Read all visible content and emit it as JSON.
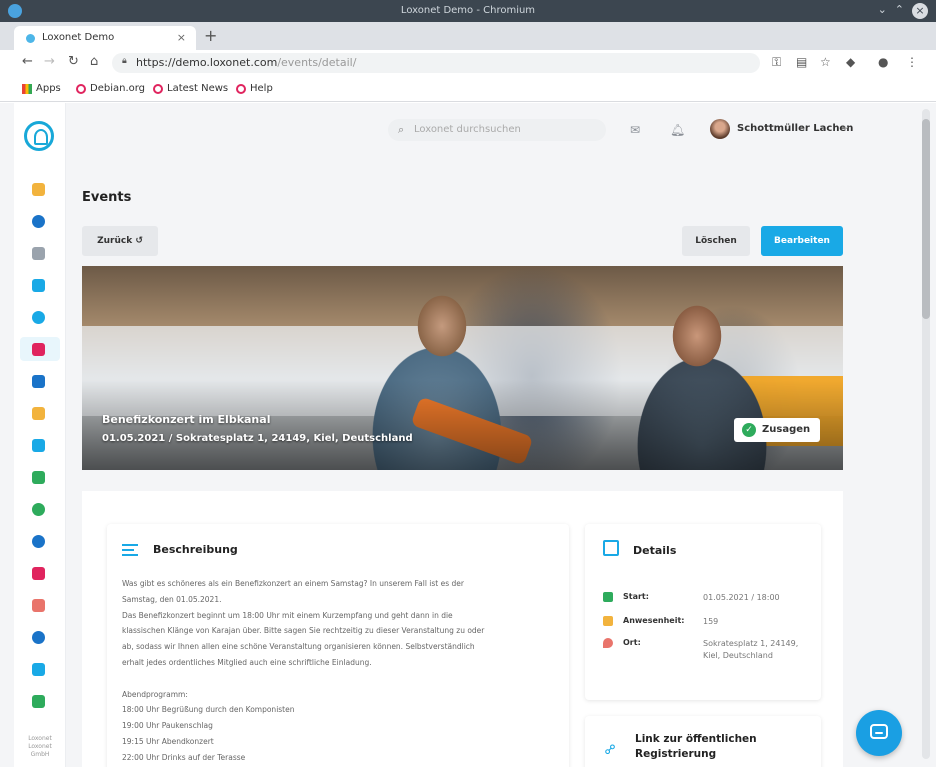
{
  "os": {
    "title": "Loxonet Demo - Chromium"
  },
  "browser": {
    "tab_label": "Loxonet Demo",
    "url_host": "https://demo.loxonet.com",
    "url_path": "/events/detail/",
    "bookmarks": [
      "Apps",
      "Debian.org",
      "Latest News",
      "Help"
    ]
  },
  "sidebar": {
    "footer": "Loxonet\nLoxonet\nGmbH"
  },
  "header": {
    "search_placeholder": "Loxonet durchsuchen",
    "username": "Schottmüller Lachen"
  },
  "page": {
    "title": "Events",
    "back_label": "Zurück",
    "delete_label": "Löschen",
    "edit_label": "Bearbeiten"
  },
  "banner": {
    "title": "Benefizkonzert im Elbkanal",
    "subtitle": "01.05.2021 / Sokratesplatz 1, 24149, Kiel, Deutschland",
    "accept_label": "Zusagen"
  },
  "description": {
    "title": "Beschreibung",
    "lines": [
      "Was gibt es schöneres als ein Benefizkonzert an einem Samstag? In unserem Fall ist es der",
      "Samstag, den 01.05.2021.",
      "Das Benefizkonzert beginnt um 18:00 Uhr mit einem Kurzempfang und geht dann in die",
      "klassischen Klänge von Karajan über. Bitte sagen Sie rechtzeitig zu dieser Veranstaltung zu oder",
      "ab, sodass wir Ihnen allen eine schöne Veranstaltung organisieren können. Selbstverständlich",
      "erhalt jedes ordentliches Mitglied auch eine schriftliche Einladung.",
      "",
      "Abendprogramm:",
      "18:00 Uhr Begrüßung durch den Komponisten",
      "19:00 Uhr Paukenschlag",
      "19:15 Uhr Abendkonzert",
      "22:00 Uhr Drinks auf der Terasse"
    ]
  },
  "details": {
    "title": "Details",
    "rows": [
      {
        "key": "Start:",
        "value": "01.05.2021 / 18:00",
        "color": "#2eab5c"
      },
      {
        "key": "Anwesenheit:",
        "value": "159",
        "color": "#f2b33d"
      },
      {
        "key": "Ort:",
        "value": "Sokratesplatz 1, 24149, Kiel, Deutschland",
        "color": "#e9746b"
      }
    ]
  },
  "registration": {
    "title": "Link zur öffentlichen Registrierung"
  },
  "colors": {
    "accent": "#19a9e6",
    "success": "#2eab5c"
  }
}
